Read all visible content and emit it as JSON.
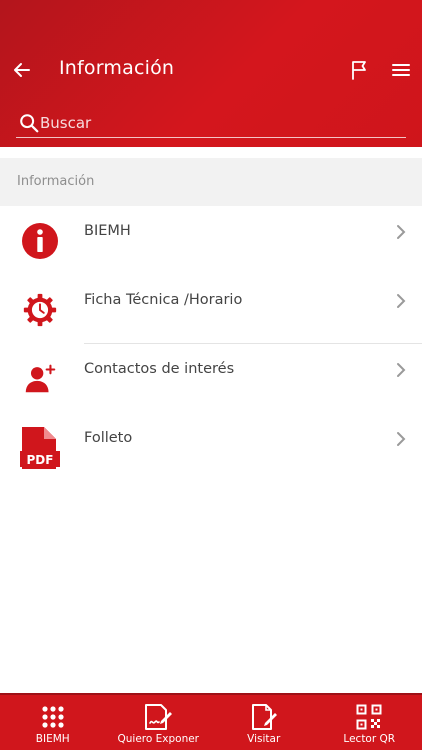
{
  "header": {
    "title": "Información",
    "back_icon": "arrow-left-icon",
    "flag_icon": "flag-icon",
    "menu_icon": "hamburger-menu-icon"
  },
  "search": {
    "placeholder": "Buscar",
    "value": ""
  },
  "section": {
    "title": "Información"
  },
  "items": [
    {
      "label": "BIEMH",
      "icon": "info-icon"
    },
    {
      "label": "Ficha Técnica /Horario",
      "icon": "gear-clock-icon"
    },
    {
      "label": "Contactos de interés",
      "icon": "add-contact-icon"
    },
    {
      "label": "Folleto",
      "icon": "pdf-file-icon"
    }
  ],
  "tabs": [
    {
      "label": "BIEMH",
      "icon": "grid-dots-icon"
    },
    {
      "label": "Quiero Exponer",
      "icon": "sign-document-icon"
    },
    {
      "label": "Visitar",
      "icon": "edit-document-icon"
    },
    {
      "label": "Lector QR",
      "icon": "qr-code-icon"
    }
  ],
  "colors": {
    "brand_red": "#d0161c",
    "brand_red_dark": "#b3151c",
    "text": "#444444",
    "muted": "#8e8e8e",
    "section_bg": "#f2f2f2"
  }
}
